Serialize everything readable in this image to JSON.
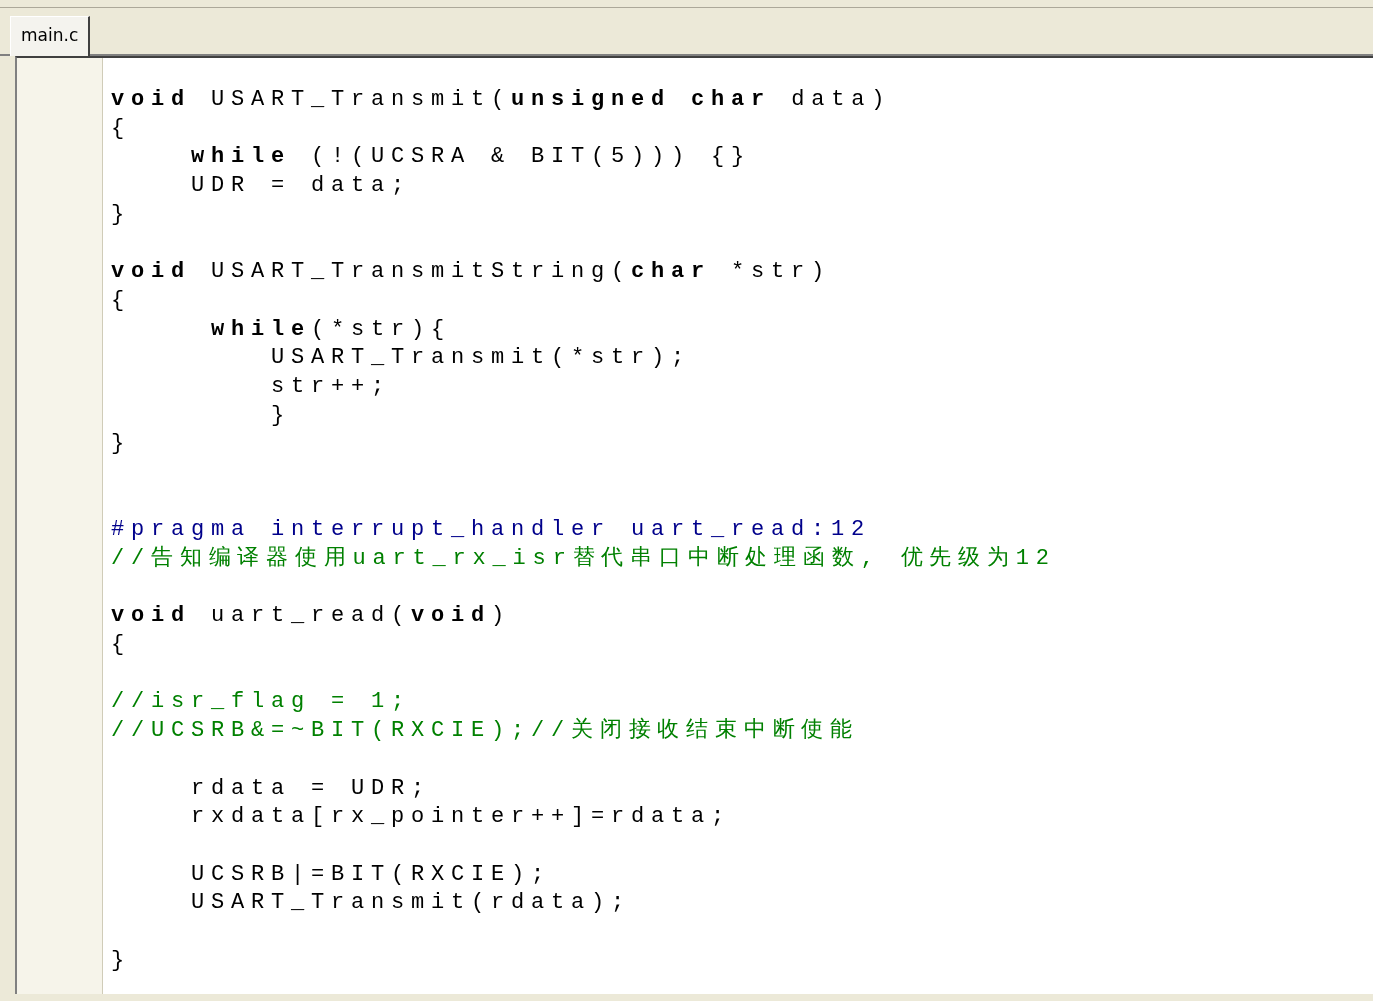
{
  "tabs": [
    {
      "label": "main.c",
      "selected": true
    }
  ],
  "code_lines": [
    {
      "kind": "code",
      "text": "**void** USART_Transmit(**unsigned** **char** data)"
    },
    {
      "kind": "code",
      "text": "{"
    },
    {
      "kind": "code",
      "text": "    **while** (!(UCSRA & BIT(5))) {}"
    },
    {
      "kind": "code",
      "text": "    UDR = data;"
    },
    {
      "kind": "code",
      "text": "}"
    },
    {
      "kind": "blank"
    },
    {
      "kind": "code",
      "text": "**void** USART_TransmitString(**char** *str)"
    },
    {
      "kind": "code",
      "text": "{"
    },
    {
      "kind": "code",
      "text": "     **while**(*str){"
    },
    {
      "kind": "code",
      "text": "        USART_Transmit(*str);"
    },
    {
      "kind": "code",
      "text": "        str++;"
    },
    {
      "kind": "code",
      "text": "        }"
    },
    {
      "kind": "code",
      "text": "}"
    },
    {
      "kind": "blank"
    },
    {
      "kind": "blank"
    },
    {
      "kind": "preprocessor",
      "text": "#pragma interrupt_handler uart_read:12"
    },
    {
      "kind": "comment",
      "text": "//告知编译器使用uart_rx_isr替代串口中断处理函数, 优先级为12"
    },
    {
      "kind": "blank"
    },
    {
      "kind": "code",
      "text": "**void** uart_read(**void**)"
    },
    {
      "kind": "code",
      "text": "{"
    },
    {
      "kind": "blank"
    },
    {
      "kind": "comment",
      "text": "//isr_flag = 1;"
    },
    {
      "kind": "comment",
      "text": "//UCSRB&=~BIT(RXCIE);//关闭接收结束中断使能"
    },
    {
      "kind": "blank"
    },
    {
      "kind": "code",
      "text": "    rdata = UDR;"
    },
    {
      "kind": "code",
      "text": "    rxdata[rx_pointer++]=rdata;"
    },
    {
      "kind": "blank"
    },
    {
      "kind": "code",
      "text": "    UCSRB|=BIT(RXCIE);"
    },
    {
      "kind": "code",
      "text": "    USART_Transmit(rdata);"
    },
    {
      "kind": "blank"
    },
    {
      "kind": "code",
      "text": "}"
    }
  ]
}
